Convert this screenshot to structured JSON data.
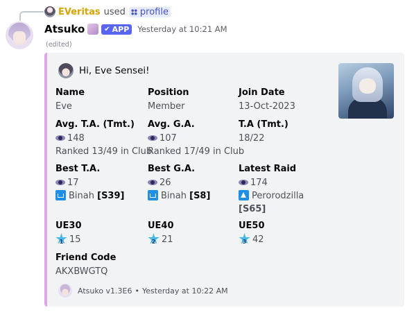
{
  "reply": {
    "username": "EVeritas",
    "used_text": "used",
    "command": "profile"
  },
  "message": {
    "bot_name": "Atsuko",
    "app_badge": "APP",
    "timestamp": "Yesterday at 10:21 AM",
    "edited": "(edited)"
  },
  "embed": {
    "color": "#dba7e6",
    "author": "Hi, Eve Sensei!",
    "fields": {
      "name": {
        "label": "Name",
        "value": "Eve"
      },
      "position": {
        "label": "Position",
        "value": "Member"
      },
      "join_date": {
        "label": "Join Date",
        "value": "13-Oct-2023"
      },
      "avg_ta": {
        "label": "Avg. T.A. (Tmt.)",
        "value": "148",
        "rank": "Ranked 13/49 in Club"
      },
      "avg_ga": {
        "label": "Avg. G.A.",
        "value": "107",
        "rank": "Ranked 17/49 in Club"
      },
      "ta_tmt": {
        "label": "T.A (Tmt.)",
        "value": "18/22"
      },
      "best_ta": {
        "label": "Best T.A.",
        "value": "17",
        "boss": "Binah",
        "season": "[S39]"
      },
      "best_ga": {
        "label": "Best G.A.",
        "value": "26",
        "boss": "Binah",
        "season": "[S8]"
      },
      "latest_raid": {
        "label": "Latest Raid",
        "value": "174",
        "boss": "Perorodzilla",
        "season": "[S65]"
      },
      "ue30": {
        "label": "UE30",
        "star": "1",
        "value": "15"
      },
      "ue40": {
        "label": "UE40",
        "star": "2",
        "value": "21"
      },
      "ue50": {
        "label": "UE50",
        "star": "3",
        "value": "42"
      },
      "friend_code": {
        "label": "Friend Code",
        "value": "AKXBWGTQ"
      }
    },
    "footer": {
      "text": "Atsuko v1.3E6",
      "separator": "•",
      "timestamp": "Yesterday at 10:22 AM"
    }
  }
}
